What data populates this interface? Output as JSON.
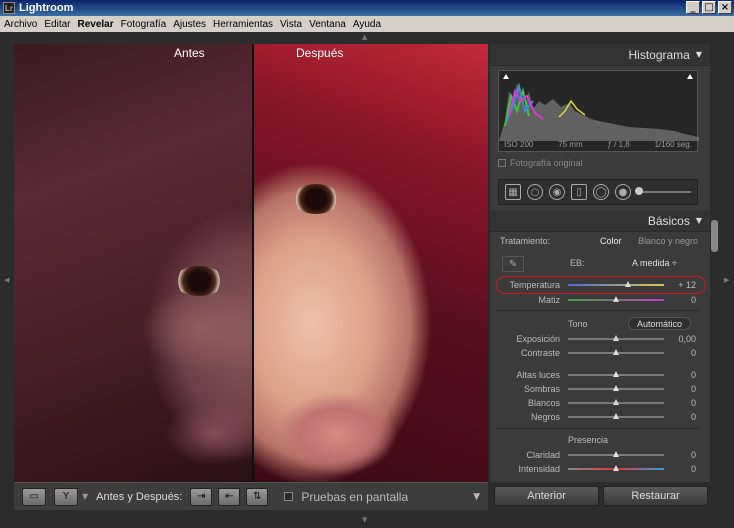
{
  "window": {
    "title": "Lightroom",
    "app_icon": "Lr",
    "min": "_",
    "max": "□",
    "close": "×"
  },
  "menu": [
    "Archivo",
    "Editar",
    "Revelar",
    "Fotografía",
    "Ajustes",
    "Herramientas",
    "Vista",
    "Ventana",
    "Ayuda"
  ],
  "photo": {
    "before_label": "Antes",
    "after_label": "Después"
  },
  "toolbar": {
    "before_after_label": "Antes y Después:",
    "proof_label": "Pruebas en pantalla"
  },
  "histogram": {
    "title": "Histograma",
    "iso": "ISO 200",
    "focal": "75 mm",
    "aperture": "ƒ / 1,8",
    "shutter": "1/160 seg.",
    "original_photo_label": "Fotografía original"
  },
  "basic": {
    "title": "Básicos",
    "treatment_label": "Tratamiento:",
    "treatment_color": "Color",
    "treatment_bw": "Blanco y negro",
    "wb_label": "EB:",
    "wb_value": "A medida ÷",
    "temperature": {
      "label": "Temperatura",
      "value": "+ 12",
      "position": 0.63
    },
    "tint": {
      "label": "Matiz",
      "value": "0",
      "position": 0.5
    },
    "tone_label": "Tono",
    "auto_label": "Automático",
    "exposure": {
      "label": "Exposición",
      "value": "0,00",
      "position": 0.5
    },
    "contrast": {
      "label": "Contraste",
      "value": "0",
      "position": 0.5
    },
    "highlights": {
      "label": "Altas luces",
      "value": "0",
      "position": 0.5
    },
    "shadows": {
      "label": "Sombras",
      "value": "0",
      "position": 0.5
    },
    "whites": {
      "label": "Blancos",
      "value": "0",
      "position": 0.5
    },
    "blacks": {
      "label": "Negros",
      "value": "0",
      "position": 0.5
    },
    "presence_label": "Presencia",
    "clarity": {
      "label": "Claridad",
      "value": "0",
      "position": 0.5
    },
    "vibrance": {
      "label": "Intensidad",
      "value": "0",
      "position": 0.5
    }
  },
  "buttons": {
    "previous": "Anterior",
    "reset": "Restaurar"
  },
  "colors": {
    "highlight_ring": "#d01818",
    "panel_bg": "#3b3b3b",
    "workspace_bg": "#2c2c2c"
  }
}
